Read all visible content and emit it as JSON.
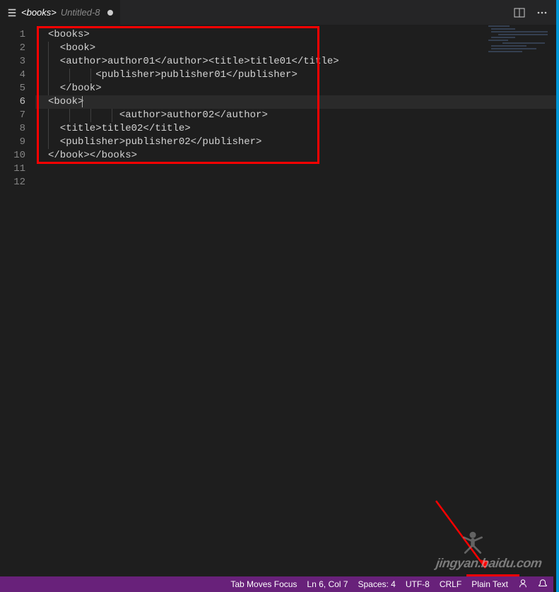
{
  "tab": {
    "title_main": "<books>",
    "title_sub": "Untitled-8"
  },
  "lines": [
    {
      "n": 1,
      "indent": 0,
      "text": "<books>"
    },
    {
      "n": 2,
      "indent": 1,
      "text": "  <book>"
    },
    {
      "n": 3,
      "indent": 1,
      "text": "  <author>author01</author><title>title01</title>"
    },
    {
      "n": 4,
      "indent": 3,
      "text": "        <publisher>publisher01</publisher>"
    },
    {
      "n": 5,
      "indent": 1,
      "text": "  </book>"
    },
    {
      "n": 6,
      "indent": 0,
      "text": "<book>",
      "active": true,
      "cursor_after": true
    },
    {
      "n": 7,
      "indent": 4,
      "text": "            <author>author02</author>"
    },
    {
      "n": 8,
      "indent": 1,
      "text": "  <title>title02</title>"
    },
    {
      "n": 9,
      "indent": 1,
      "text": "  <publisher>publisher02</publisher>"
    },
    {
      "n": 10,
      "indent": 0,
      "text": "</book></books>"
    },
    {
      "n": 11,
      "indent": 0,
      "text": ""
    },
    {
      "n": 12,
      "indent": 0,
      "text": ""
    }
  ],
  "statusbar": {
    "tab_moves_focus": "Tab Moves Focus",
    "cursor": "Ln 6, Col 7",
    "spaces": "Spaces: 4",
    "encoding": "UTF-8",
    "eol": "CRLF",
    "language": "Plain Text"
  },
  "watermark": "jingyan.baidu.com"
}
